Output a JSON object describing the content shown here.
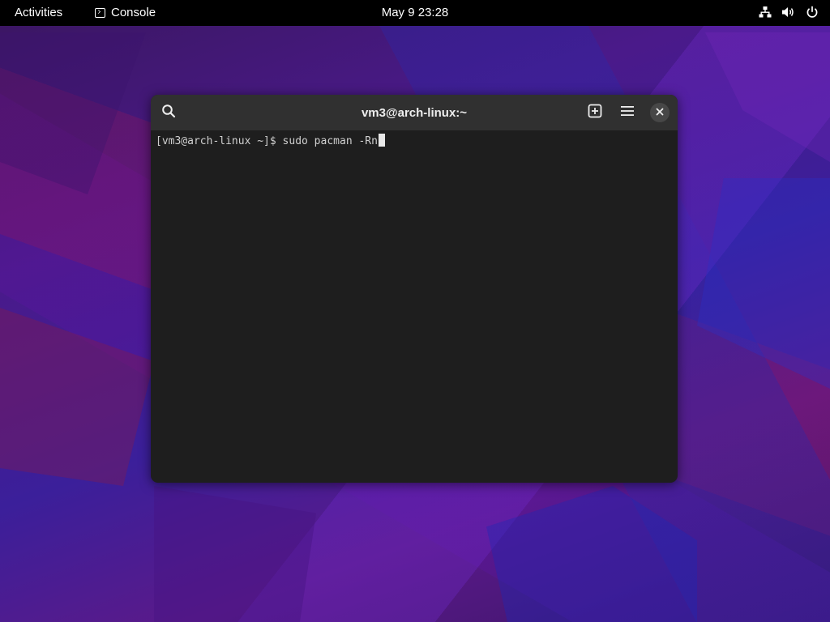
{
  "topbar": {
    "activities_label": "Activities",
    "app_label": "Console",
    "app_icon": "terminal-icon",
    "clock": "May 9  23:28",
    "tray_icons": [
      "network-icon",
      "volume-icon",
      "power-icon"
    ]
  },
  "terminal": {
    "title": "vm3@arch-linux:~",
    "prompt": "[vm3@arch-linux ~]$ ",
    "command": "sudo pacman -Rn",
    "header_icons": [
      "search-icon",
      "new-tab-icon",
      "menu-icon",
      "close-icon"
    ]
  },
  "colors": {
    "topbar_bg": "#000000",
    "header_bg": "#303030",
    "terminal_bg": "#1e1e1e"
  }
}
